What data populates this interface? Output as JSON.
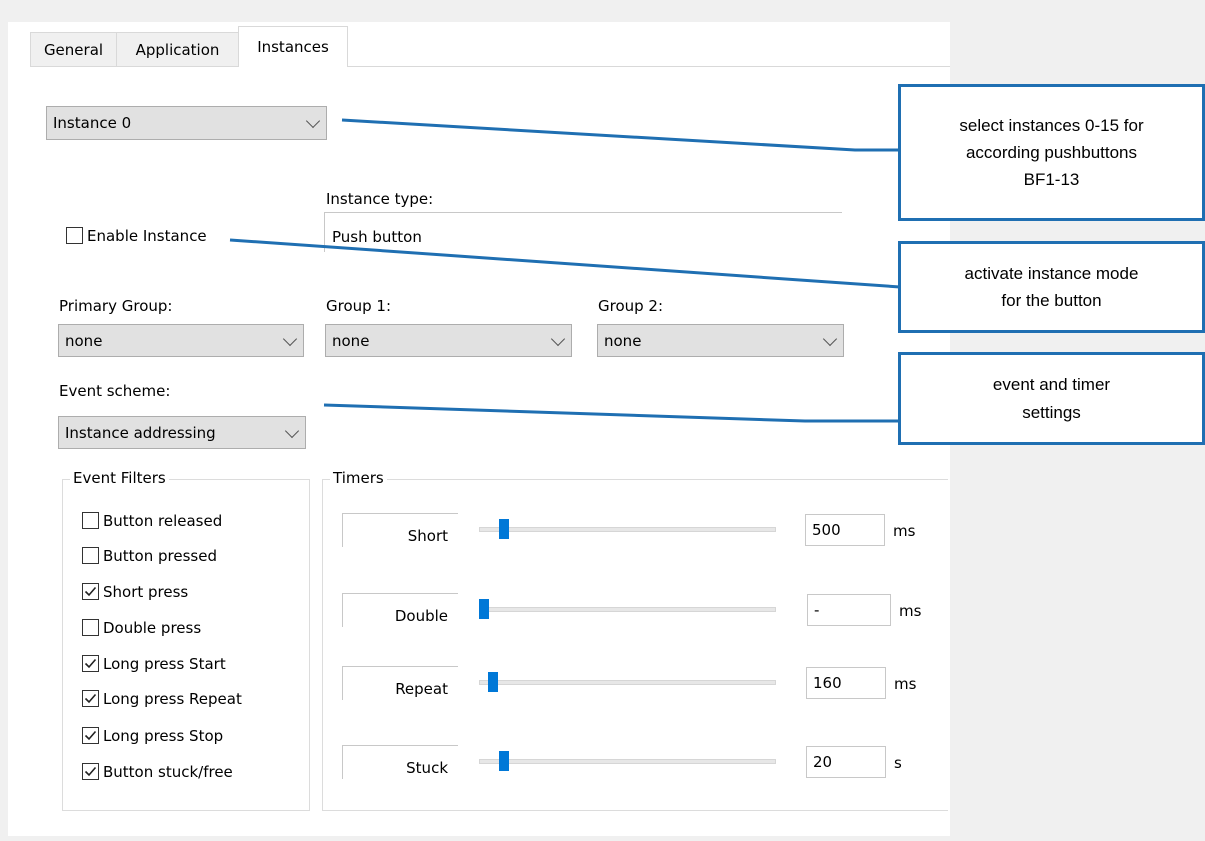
{
  "tabs": [
    {
      "label": "General",
      "active": false
    },
    {
      "label": "Application",
      "active": false
    },
    {
      "label": "Instances",
      "active": true
    }
  ],
  "instance_select": {
    "value": "Instance 0"
  },
  "instance_type": {
    "label": "Instance type:",
    "value": "Push button"
  },
  "enable_instance": {
    "label": "Enable Instance",
    "checked": false
  },
  "groups": {
    "primary": {
      "label": "Primary Group:",
      "value": "none"
    },
    "group1": {
      "label": "Group 1:",
      "value": "none"
    },
    "group2": {
      "label": "Group 2:",
      "value": "none"
    }
  },
  "event_scheme": {
    "label": "Event scheme:",
    "value": "Instance addressing"
  },
  "event_filters": {
    "title": "Event Filters",
    "items": [
      {
        "label": "Button released",
        "checked": false
      },
      {
        "label": "Button pressed",
        "checked": false
      },
      {
        "label": "Short press",
        "checked": true
      },
      {
        "label": "Double press",
        "checked": false
      },
      {
        "label": "Long press Start",
        "checked": true
      },
      {
        "label": "Long press Repeat",
        "checked": true
      },
      {
        "label": "Long press Stop",
        "checked": true
      },
      {
        "label": "Button stuck/free",
        "checked": true
      }
    ]
  },
  "timers": {
    "title": "Timers",
    "items": [
      {
        "label": "Short",
        "value": "500",
        "unit": "ms",
        "slider_fraction": 0.07
      },
      {
        "label": "Double",
        "value": "-",
        "unit": "ms",
        "slider_fraction": 0.0
      },
      {
        "label": "Repeat",
        "value": "160",
        "unit": "ms",
        "slider_fraction": 0.03
      },
      {
        "label": "Stuck",
        "value": "20",
        "unit": "s",
        "slider_fraction": 0.07
      }
    ]
  },
  "callouts": [
    {
      "lines": [
        "select instances 0-15 for",
        "according pushbuttons",
        "BF1-13"
      ]
    },
    {
      "lines": [
        "activate instance mode",
        "for the button"
      ]
    },
    {
      "lines": [
        "event and timer",
        "settings"
      ]
    }
  ],
  "colors": {
    "accent": "#1f6fb2",
    "slider_thumb": "#0078d7"
  }
}
